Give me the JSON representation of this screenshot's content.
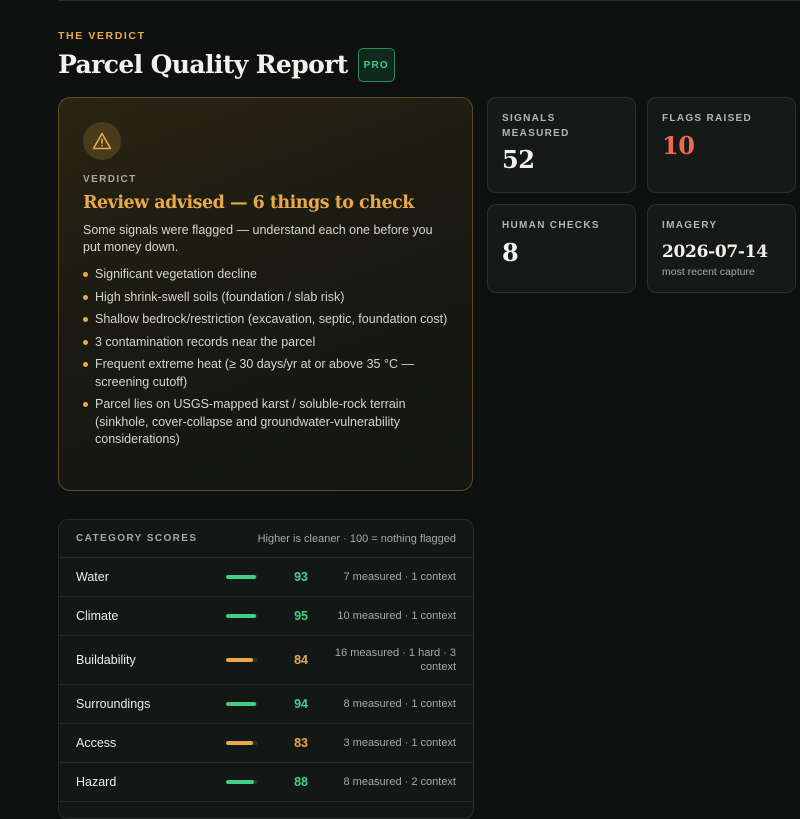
{
  "header": {
    "eyebrow": "THE VERDICT",
    "title": "Parcel Quality Report",
    "badge": "PRO"
  },
  "verdict": {
    "icon": "warning-icon",
    "label": "VERDICT",
    "headline": "Review advised — 6 things to check",
    "description": "Some signals were flagged — understand each one before you put money down.",
    "items": [
      "Significant vegetation decline",
      "High shrink-swell soils (foundation / slab risk)",
      "Shallow bedrock/restriction (excavation, septic, foundation cost)",
      "3 contamination records near the parcel",
      "Frequent extreme heat (≥ 30 days/yr at or above 35 °C — screening cutoff)",
      "Parcel lies on USGS-mapped karst / soluble-rock terrain (sinkhole, cover-collapse and groundwater-vulnerability considerations)"
    ]
  },
  "stats": {
    "signals_label": "SIGNALS MEASURED",
    "signals_value": "52",
    "flags_label": "FLAGS RAISED",
    "flags_value": "10",
    "human_label": "HUMAN CHECKS",
    "human_value": "8",
    "imagery_label": "IMAGERY",
    "imagery_value": "2026-07-14",
    "imagery_sub": "most recent capture"
  },
  "scores": {
    "title": "CATEGORY SCORES",
    "note": "Higher is cleaner · 100 = nothing flagged",
    "rows": [
      {
        "name": "Water",
        "score": "93",
        "detail": "7 measured · 1 context",
        "color": "#3fcf85"
      },
      {
        "name": "Climate",
        "score": "95",
        "detail": "10 measured · 1 context",
        "color": "#3fcf85"
      },
      {
        "name": "Buildability",
        "score": "84",
        "detail": "16 measured · 1 hard · 3 context",
        "color": "#e8a94a"
      },
      {
        "name": "Surroundings",
        "score": "94",
        "detail": "8 measured · 1 context",
        "color": "#3fcf85"
      },
      {
        "name": "Access",
        "score": "83",
        "detail": "3 measured · 1 context",
        "color": "#e8a94a"
      },
      {
        "name": "Hazard",
        "score": "88",
        "detail": "8 measured · 2 context",
        "color": "#3fcf85"
      }
    ]
  },
  "colors": {
    "accent_amber": "#e8a94a",
    "accent_green": "#3fcf85",
    "flag_red": "#ef6a50",
    "background": "#0e1110"
  }
}
